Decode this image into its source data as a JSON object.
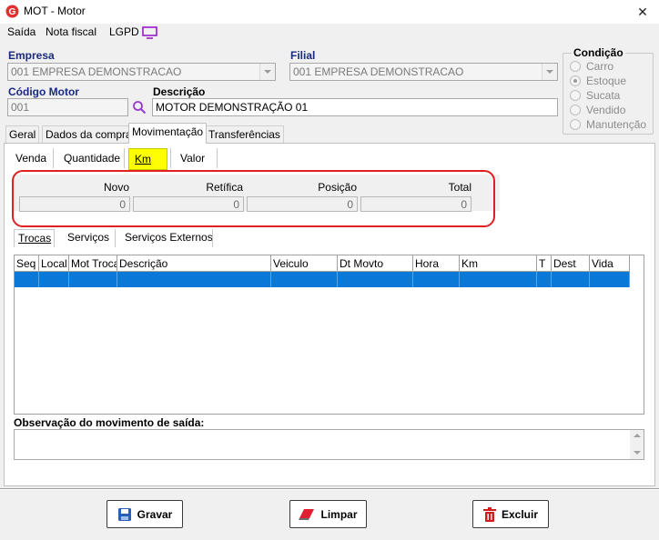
{
  "window": {
    "title": "MOT - Motor",
    "close_glyph": "✕"
  },
  "menu": {
    "items": [
      "Saída",
      "Nota fiscal",
      "LGPD"
    ]
  },
  "empresa": {
    "label": "Empresa",
    "value": "001 EMPRESA DEMONSTRACAO"
  },
  "filial": {
    "label": "Filial",
    "value": "001 EMPRESA DEMONSTRACAO"
  },
  "condicao": {
    "label": "Condição",
    "options": [
      "Carro",
      "Estoque",
      "Sucata",
      "Vendido",
      "Manutenção"
    ],
    "selected": "Estoque"
  },
  "codigo": {
    "label": "Código Motor",
    "value": "001"
  },
  "descricao": {
    "label": "Descrição",
    "value": "MOTOR DEMONSTRAÇÃO 01"
  },
  "tabs": [
    "Geral",
    "Dados da compra",
    "Movimentação",
    "Transferências"
  ],
  "active_tab": "Movimentação",
  "subtabs": [
    "Venda",
    "Quantidade",
    "Km",
    "Valor"
  ],
  "active_subtab": "Km",
  "km_fields": [
    {
      "label": "Novo",
      "value": "0"
    },
    {
      "label": "Retífica",
      "value": "0"
    },
    {
      "label": "Posição",
      "value": "0"
    },
    {
      "label": "Total",
      "value": "0"
    }
  ],
  "lower_tabs": [
    "Trocas",
    "Serviços",
    "Serviços Externos"
  ],
  "grid": {
    "columns": [
      "Seq",
      "Local",
      "Mot Troca",
      "Descrição",
      "Veiculo",
      "Dt Movto",
      "Hora",
      "Km",
      "T",
      "Dest",
      "Vida"
    ]
  },
  "observacao": {
    "label": "Observação do movimento de saída:",
    "value": ""
  },
  "buttons": {
    "save": "Gravar",
    "clear": "Limpar",
    "delete": "Excluir"
  },
  "colors": {
    "highlight_tab": "#ffff00",
    "selection": "#0a78d7",
    "annotation": "#e02020",
    "label_blue": "#1a2a80"
  }
}
